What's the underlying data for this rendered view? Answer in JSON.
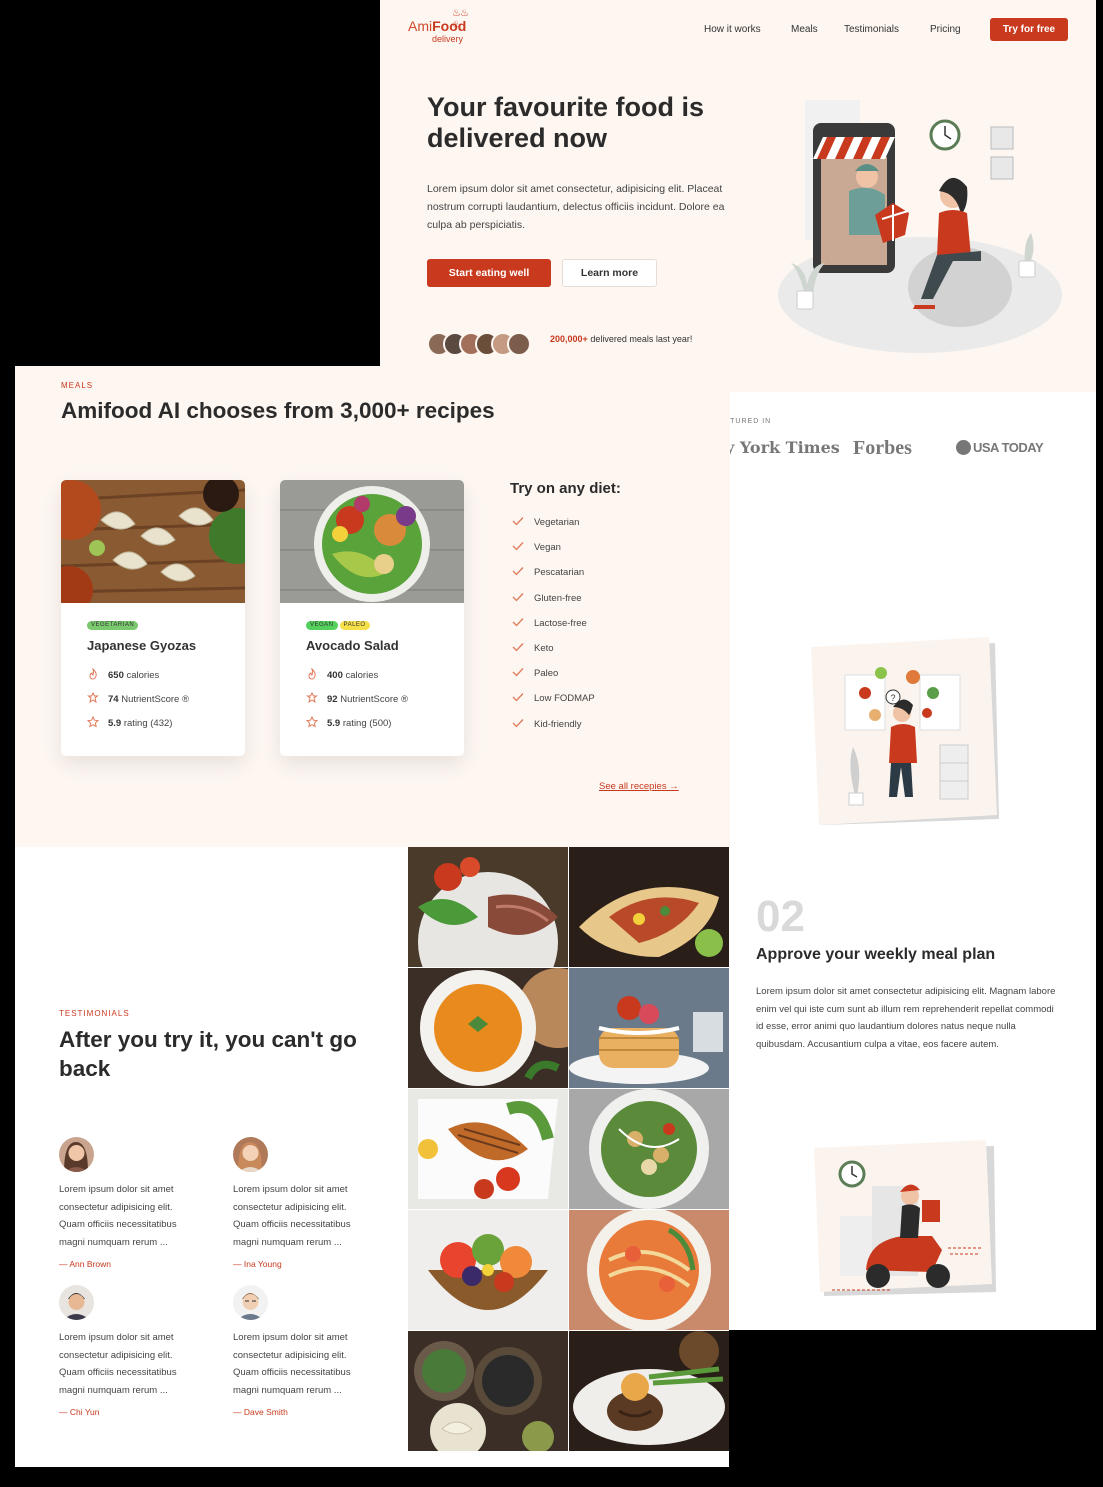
{
  "brand": {
    "name_part1": "Ami",
    "name_part2": "Food",
    "tagline": "delivery",
    "steam": "♨♨♨"
  },
  "nav": {
    "items": [
      {
        "label": "How it works"
      },
      {
        "label": "Meals"
      },
      {
        "label": "Testimonials"
      },
      {
        "label": "Pricing"
      }
    ],
    "cta_label": "Try for free"
  },
  "hero": {
    "title": "Your favourite food is delivered now",
    "body": "Lorem ipsum dolor sit amet consectetur, adipisicing elit. Placeat nostrum corrupti laudantium, delectus officiis incidunt. Dolore ea culpa ab perspiciatis.",
    "primary_button": "Start eating well",
    "secondary_button": "Learn more",
    "social_proof_count": "200,000+",
    "social_proof_text": "delivered meals last year!"
  },
  "featured": {
    "label": "ATURED IN",
    "logos": [
      {
        "name": "y York Times"
      },
      {
        "name": "Forbes"
      },
      {
        "name": "USA TODAY"
      }
    ]
  },
  "how_it_works": {
    "step_number": "02",
    "step_title": "Approve your weekly meal plan",
    "step_body": "Lorem ipsum dolor sit amet consectetur adipisicing elit. Magnam labore enim vel qui iste cum sunt ab illum rem reprehenderit repellat commodi id esse, error animi quo laudantium dolores natus neque nulla quibusdam. Accusantium culpa a vitae, eos facere autem."
  },
  "meals": {
    "eyebrow": "MEALS",
    "title": "Amifood AI chooses from 3,000+ recipes",
    "cards": [
      {
        "tags": [
          {
            "label": "VEGETARIAN",
            "color": "#7bc96f"
          }
        ],
        "title": "Japanese Gyozas",
        "calories_value": "650",
        "calories_label": "calories",
        "nutrient_value": "74",
        "nutrient_label": "NutrientScore ®",
        "rating_value": "5.9",
        "rating_label": "rating (432)"
      },
      {
        "tags": [
          {
            "label": "VEGAN",
            "color": "#54d15c"
          },
          {
            "label": "PALEO",
            "color": "#f5e04a"
          }
        ],
        "title": "Avocado Salad",
        "calories_value": "400",
        "calories_label": "calories",
        "nutrient_value": "92",
        "nutrient_label": "NutrientScore ®",
        "rating_value": "5.9",
        "rating_label": "rating (500)"
      }
    ],
    "diet_title": "Try on any diet:",
    "diets": [
      "Vegetarian",
      "Vegan",
      "Pescatarian",
      "Gluten-free",
      "Lactose-free",
      "Keto",
      "Paleo",
      "Low FODMAP",
      "Kid-friendly"
    ],
    "see_all": "See all recepies →"
  },
  "testimonials": {
    "eyebrow": "TESTIMONIALS",
    "title": "After you try it, you can't go back",
    "items": [
      {
        "text": "Lorem ipsum dolor sit amet consectetur adipisicing elit. Quam officiis necessitatibus magni numquam rerum ...",
        "author": "— Ann Brown"
      },
      {
        "text": "Lorem ipsum dolor sit amet consectetur adipisicing elit. Quam officiis necessitatibus magni numquam rerum ...",
        "author": "— Ina Young"
      },
      {
        "text": "Lorem ipsum dolor sit amet consectetur adipisicing elit. Quam officiis necessitatibus magni numquam rerum ...",
        "author": "— Chi Yun"
      },
      {
        "text": "Lorem ipsum dolor sit amet consectetur adipisicing elit. Quam officiis necessitatibus magni numquam rerum ...",
        "author": "— Dave Smith"
      }
    ]
  },
  "gallery": {
    "photos": [
      "salad-steak-photo",
      "burrito-photo",
      "pumpkin-soup-photo",
      "pancakes-photo",
      "grilled-salmon-photo",
      "caesar-salad-photo",
      "fruit-bowl-photo",
      "noodle-soup-photo",
      "dumplings-photo",
      "steak-asparagus-photo"
    ]
  },
  "colors": {
    "accent": "#c8391e",
    "hero_bg": "#fdf6f1",
    "text": "#2b2b2b"
  }
}
